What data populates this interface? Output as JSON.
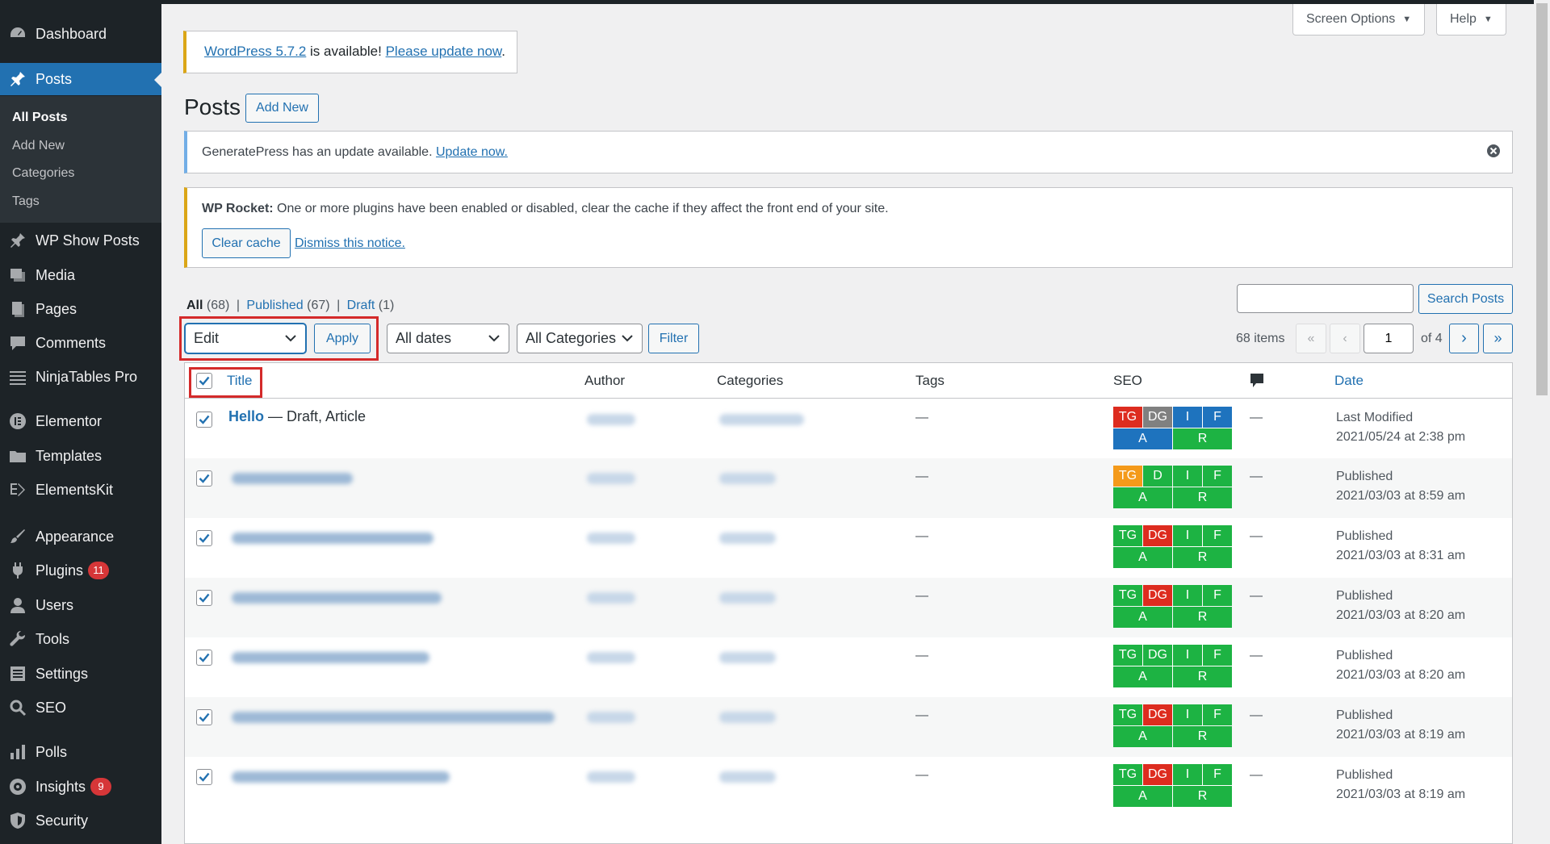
{
  "sidebar": {
    "items": [
      {
        "label": "Dashboard",
        "icon": "dashboard-icon"
      },
      {
        "label": "Posts",
        "icon": "pin-icon"
      },
      {
        "label": "WP Show Posts",
        "icon": "pin-icon"
      },
      {
        "label": "Media",
        "icon": "media-icon"
      },
      {
        "label": "Pages",
        "icon": "pages-icon"
      },
      {
        "label": "Comments",
        "icon": "comments-icon"
      },
      {
        "label": "NinjaTables Pro",
        "icon": "table-icon"
      },
      {
        "label": "Elementor",
        "icon": "elementor-icon"
      },
      {
        "label": "Templates",
        "icon": "folder-icon"
      },
      {
        "label": "ElementsKit",
        "icon": "elementskit-icon"
      },
      {
        "label": "Appearance",
        "icon": "brush-icon"
      },
      {
        "label": "Plugins",
        "icon": "plugin-icon",
        "badge": "11"
      },
      {
        "label": "Users",
        "icon": "users-icon"
      },
      {
        "label": "Tools",
        "icon": "wrench-icon"
      },
      {
        "label": "Settings",
        "icon": "settings-icon"
      },
      {
        "label": "SEO",
        "icon": "search-icon"
      },
      {
        "label": "Polls",
        "icon": "bar-chart-icon"
      },
      {
        "label": "Insights",
        "icon": "insights-icon",
        "badge": "9"
      },
      {
        "label": "Security",
        "icon": "shield-icon"
      }
    ],
    "submenu": [
      "All Posts",
      "Add New",
      "Categories",
      "Tags"
    ]
  },
  "header": {
    "screen_options": "Screen Options",
    "help": "Help"
  },
  "update_notice": {
    "link1": "WordPress 5.7.2",
    "text": " is available! ",
    "link2": "Please update now",
    "end": "."
  },
  "page": {
    "title": "Posts",
    "add_new": "Add New"
  },
  "gp_notice": {
    "text": "GeneratePress has an update available. ",
    "link": "Update now."
  },
  "rocket_notice": {
    "strong": "WP Rocket:",
    "text": " One or more plugins have been enabled or disabled, clear the cache if they affect the front end of your site.",
    "clear_cache": "Clear cache",
    "dismiss": "Dismiss this notice."
  },
  "filters": {
    "all": "All",
    "all_count": " (68)",
    "published": "Published",
    "published_count": " (67)",
    "draft": "Draft",
    "draft_count": " (1)",
    "sep": "|"
  },
  "search": {
    "value": "",
    "button": "Search Posts"
  },
  "bulk": {
    "action": "Edit",
    "apply": "Apply",
    "dates": "All dates",
    "categories": "All Categories",
    "filter": "Filter"
  },
  "pagination": {
    "items": "68 items",
    "first": "«",
    "prev": "‹",
    "current": "1",
    "of": "of 4",
    "next": "›",
    "last": "»"
  },
  "table": {
    "columns": {
      "title": "Title",
      "author": "Author",
      "categories": "Categories",
      "tags": "Tags",
      "seo": "SEO",
      "comments_icon": "comment-icon",
      "date": "Date"
    },
    "rows": [
      {
        "title": "Hello",
        "suffix": " — Draft, Article",
        "tags": "—",
        "comments": "—",
        "status": "Last Modified",
        "date": "2021/05/24 at 2:38 pm",
        "seo_top": [
          [
            "TG",
            "#dd2c1f"
          ],
          [
            "DG",
            "#808080"
          ],
          [
            "I",
            "#1e73be"
          ],
          [
            "F",
            "#1e73be"
          ]
        ],
        "seo_bot": [
          [
            "A",
            "#1e73be"
          ],
          [
            "R",
            "#1db343"
          ]
        ]
      },
      {
        "tags": "—",
        "comments": "—",
        "status": "Published",
        "date": "2021/03/03 at 8:59 am",
        "seo_top": [
          [
            "TG",
            "#f49a1a"
          ],
          [
            "D",
            "#1db343"
          ],
          [
            "I",
            "#1db343"
          ],
          [
            "F",
            "#1db343"
          ]
        ],
        "seo_bot": [
          [
            "A",
            "#1db343"
          ],
          [
            "R",
            "#1db343"
          ]
        ]
      },
      {
        "tags": "—",
        "comments": "—",
        "status": "Published",
        "date": "2021/03/03 at 8:31 am",
        "seo_top": [
          [
            "TG",
            "#1db343"
          ],
          [
            "DG",
            "#dd2c1f"
          ],
          [
            "I",
            "#1db343"
          ],
          [
            "F",
            "#1db343"
          ]
        ],
        "seo_bot": [
          [
            "A",
            "#1db343"
          ],
          [
            "R",
            "#1db343"
          ]
        ]
      },
      {
        "tags": "—",
        "comments": "—",
        "status": "Published",
        "date": "2021/03/03 at 8:20 am",
        "seo_top": [
          [
            "TG",
            "#1db343"
          ],
          [
            "DG",
            "#dd2c1f"
          ],
          [
            "I",
            "#1db343"
          ],
          [
            "F",
            "#1db343"
          ]
        ],
        "seo_bot": [
          [
            "A",
            "#1db343"
          ],
          [
            "R",
            "#1db343"
          ]
        ]
      },
      {
        "tags": "—",
        "comments": "—",
        "status": "Published",
        "date": "2021/03/03 at 8:20 am",
        "seo_top": [
          [
            "TG",
            "#1db343"
          ],
          [
            "DG",
            "#1db343"
          ],
          [
            "I",
            "#1db343"
          ],
          [
            "F",
            "#1db343"
          ]
        ],
        "seo_bot": [
          [
            "A",
            "#1db343"
          ],
          [
            "R",
            "#1db343"
          ]
        ]
      },
      {
        "tags": "—",
        "comments": "—",
        "status": "Published",
        "date": "2021/03/03 at 8:19 am",
        "seo_top": [
          [
            "TG",
            "#1db343"
          ],
          [
            "DG",
            "#dd2c1f"
          ],
          [
            "I",
            "#1db343"
          ],
          [
            "F",
            "#1db343"
          ]
        ],
        "seo_bot": [
          [
            "A",
            "#1db343"
          ],
          [
            "R",
            "#1db343"
          ]
        ]
      },
      {
        "tags": "—",
        "comments": "—",
        "status": "Published",
        "date": "2021/03/03 at 8:19 am",
        "seo_top": [
          [
            "TG",
            "#1db343"
          ],
          [
            "DG",
            "#dd2c1f"
          ],
          [
            "I",
            "#1db343"
          ],
          [
            "F",
            "#1db343"
          ]
        ],
        "seo_bot": [
          [
            "A",
            "#1db343"
          ],
          [
            "R",
            "#1db343"
          ]
        ]
      }
    ]
  },
  "colors": {
    "sidebar_bg": "#1d2327",
    "accent": "#2271b1",
    "highlight_box": "#d42a2a"
  }
}
